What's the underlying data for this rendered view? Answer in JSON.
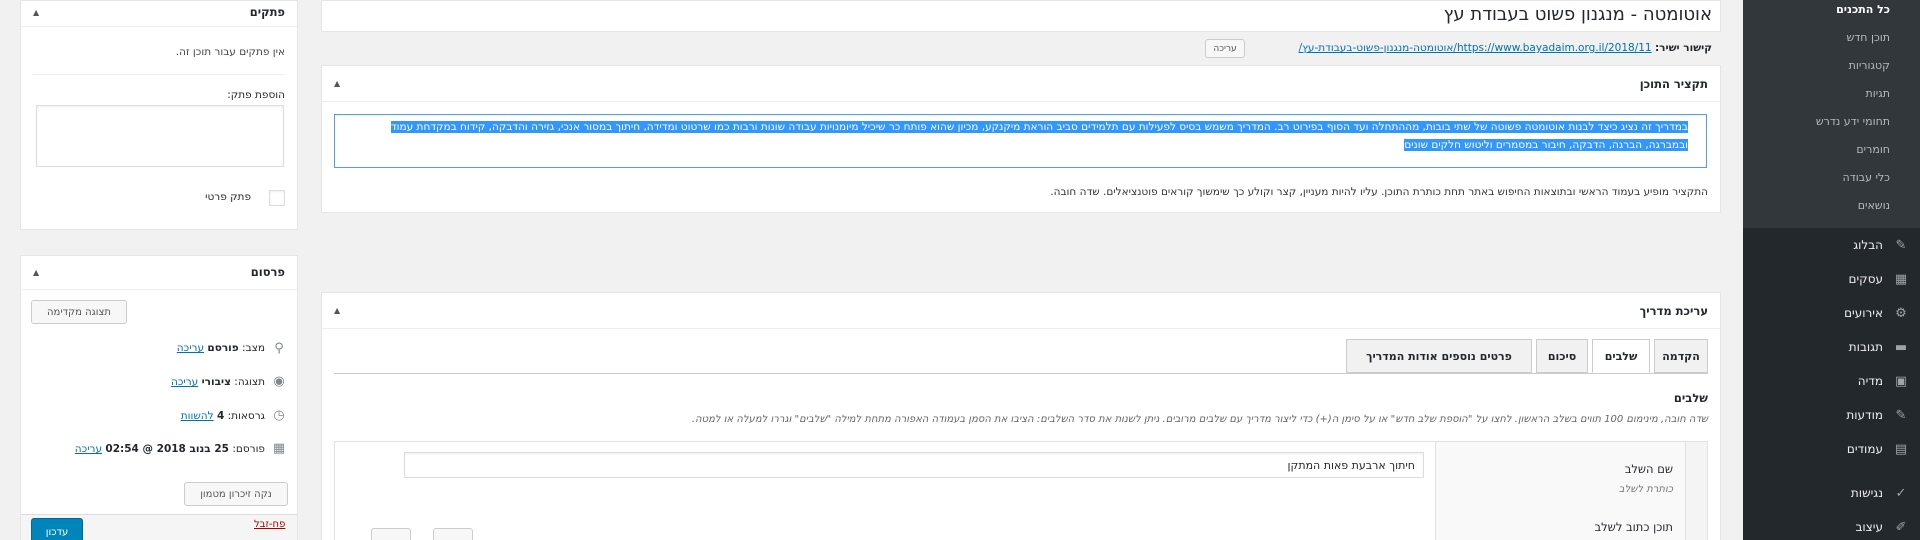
{
  "post": {
    "title": "אוטומטה - מנגנון פשוט בעבודת עץ",
    "permalink_label": "קישור ישיר:",
    "permalink_url": "https://www.bayadaim.org.il/2018/11/אוטומטה-מנגנון-פשוט-בעבודת-עץ/",
    "permalink_edit": "עריכה"
  },
  "excerpt": {
    "title": "תקציר התוכן",
    "text": "במדריך זה נציג כיצד לבנות אוטומטה פשוטה של שתי בובות, מההתחלה ועד הסוף בפירוט רב. המדריך משמש בסיס לפעילות עם תלמידים סביב הוראת מיקנקע, מכיון שהוא פותח כר שיכיל מיומנויות עבודה שונות ורבות כמו שרטוט ומדידה, חיתוך במסור אנכי, גזירה והדבקה, קידוח במקדחת עמוד ובמברגה, הברגה, הדבקה, חיבור במסמרים וליטוש חלקים שונים",
    "help": "התקציר מופיע בעמוד הראשי ובתוצאות החיפוש באתר תחת כותרת התוכן. עליו להיות מעניין, קצר וקולע כך שימשוך קוראים פוטנציאלים. שדה חובה."
  },
  "guide": {
    "title": "עריכת מדריך",
    "tabs": [
      "הקדמה",
      "שלבים",
      "סיכום",
      "פרטים נוספים אודות המדריך"
    ],
    "active_tab": "שלבים",
    "steps_label": "שלבים",
    "steps_help": "שדה חובה, מינימום 100 תווים בשלב הראשון. לחצו על \"הוספת שלב חדש\" או על סימן ה(+) כדי ליצור מדריך עם שלבים מרובים. ניתן לשנות את סדר השלבים: הציבו את הסמן בעמודה האפורה מתחת למילה \"שלבים\" וגררו למעלה או למטה.",
    "step_name_label": "שם השלב",
    "step_name_sub": "כותרת לשלב",
    "step_name_value": "חיתוך ארבעת פאות המתקן",
    "step_content_label": "תוכן כתוב לשלב"
  },
  "notes": {
    "title": "פתקים",
    "empty": "אין פתקים עבור תוכן זה.",
    "add_label": "הוספת פתק:",
    "private_label": "פתק פרטי"
  },
  "publish": {
    "title": "פרסום",
    "preview": "תצוגה מקדימה",
    "status_label": "מצב:",
    "status_value": "פורסם",
    "status_edit": "עריכה",
    "visibility_label": "תצוגה:",
    "visibility_value": "ציבורי",
    "visibility_edit": "עריכה",
    "revisions_label": "גרסאות:",
    "revisions_value": "4",
    "revisions_link": "להשוות",
    "published_label": "פורסם:",
    "published_value": "25 בנוב 2018 @ 02:54",
    "published_edit": "עריכה",
    "purge_cache": "נקה זיכרון מטמון",
    "trash": "פח-זבל",
    "update": "עדכון"
  },
  "menu": {
    "submenu": [
      "כל התכנים",
      "תוכן חדש",
      "קטגוריות",
      "תגיות",
      "תחומי ידע נדרש",
      "חומרים",
      "כלי עבודה",
      "נושאים"
    ],
    "items": [
      {
        "label": "הבלוג",
        "icon": "pin-icon"
      },
      {
        "label": "עסקים",
        "icon": "store-icon"
      },
      {
        "label": "אירועים",
        "icon": "gear-icon"
      },
      {
        "label": "תגובות",
        "icon": "comment-icon"
      },
      {
        "label": "מדיה",
        "icon": "media-icon"
      },
      {
        "label": "מודעות",
        "icon": "pin-icon"
      },
      {
        "label": "עמודים",
        "icon": "page-icon"
      },
      {
        "label": "נגישות",
        "icon": "check-icon"
      },
      {
        "label": "עיצוב",
        "icon": "brush-icon"
      }
    ]
  },
  "colors": {
    "accent": "#0085ba",
    "menu_bg": "#23282d",
    "selection": "#3297fd"
  }
}
